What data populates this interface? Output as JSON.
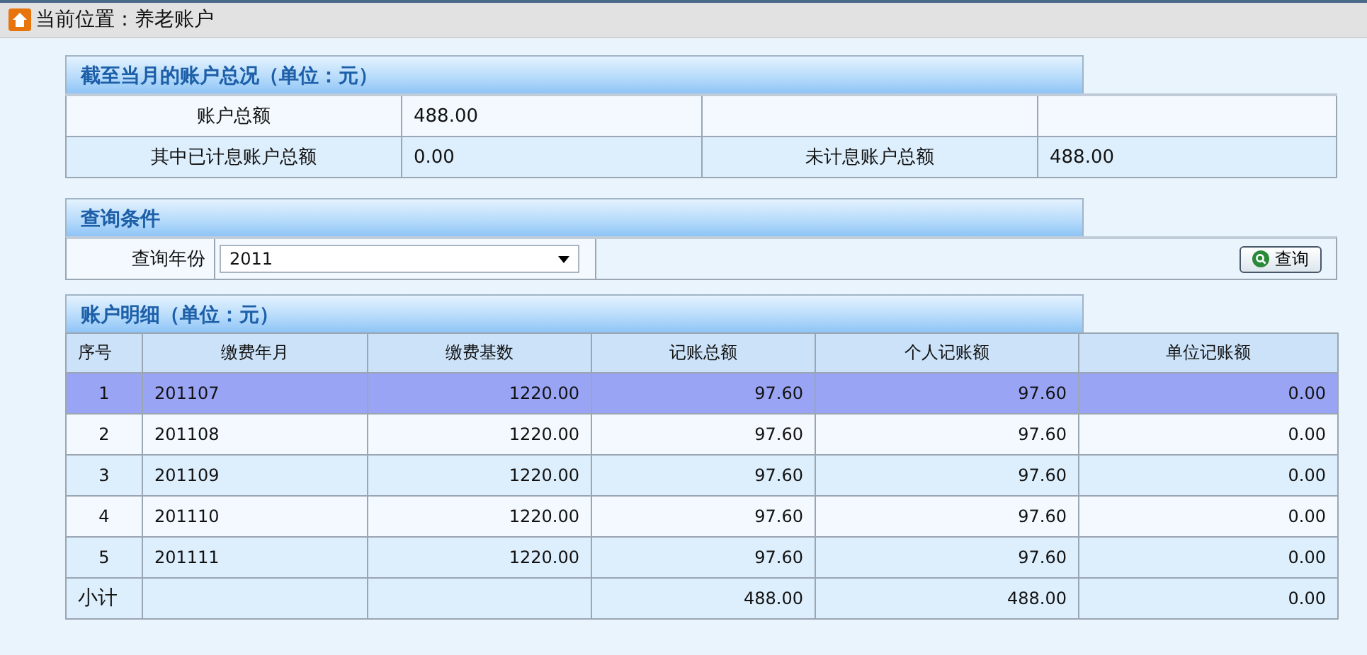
{
  "breadcrumb": "当前位置：养老账户",
  "summary": {
    "title": "截至当月的账户总况（单位：元）",
    "rows": [
      [
        "账户总额",
        "488.00"
      ],
      [
        "其中已计息账户总额",
        "0.00",
        "未计息账户总额",
        "488.00"
      ]
    ]
  },
  "query": {
    "title": "查询条件",
    "label": "查询年份",
    "year": "2011",
    "button": "查询"
  },
  "detail": {
    "title": "账户明细（单位：元）",
    "columns": [
      "序号",
      "缴费年月",
      "缴费基数",
      "记账总额",
      "个人记账额",
      "单位记账额"
    ],
    "rows": [
      {
        "selected": true,
        "cells": [
          "1",
          "201107",
          "1220.00",
          "97.60",
          "97.60",
          "0.00"
        ]
      },
      {
        "selected": false,
        "cells": [
          "2",
          "201108",
          "1220.00",
          "97.60",
          "97.60",
          "0.00"
        ]
      },
      {
        "selected": false,
        "cells": [
          "3",
          "201109",
          "1220.00",
          "97.60",
          "97.60",
          "0.00"
        ]
      },
      {
        "selected": false,
        "cells": [
          "4",
          "201110",
          "1220.00",
          "97.60",
          "97.60",
          "0.00"
        ]
      },
      {
        "selected": false,
        "cells": [
          "5",
          "201111",
          "1220.00",
          "97.60",
          "97.60",
          "0.00"
        ]
      }
    ],
    "subtotal": {
      "label": "小计",
      "total": "488.00",
      "personal": "488.00",
      "unit": "0.00"
    }
  }
}
